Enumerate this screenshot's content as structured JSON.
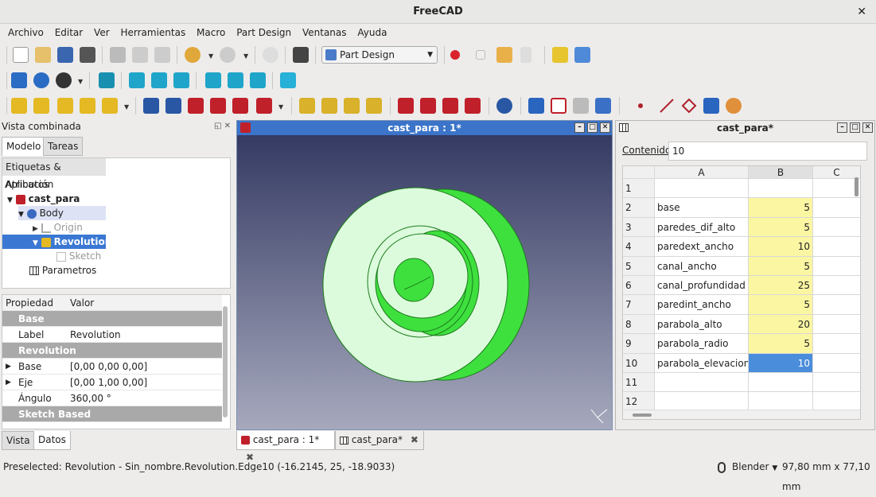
{
  "window": {
    "title": "FreeCAD",
    "close": "✕"
  },
  "menu": [
    "Archivo",
    "Editar",
    "Ver",
    "Herramientas",
    "Macro",
    "Part Design",
    "Ventanas",
    "Ayuda"
  ],
  "toolbar": {
    "workbench": "Part Design"
  },
  "combo": {
    "title": "Vista combinada",
    "tabs": [
      "Modelo",
      "Tareas"
    ],
    "tree_header": "Etiquetas & Atributos",
    "app_label": "Aplicación",
    "tree": [
      "cast_para",
      "Body",
      "Origin",
      "Revolution",
      "Sketch",
      "Parametros"
    ]
  },
  "props": {
    "col_prop": "Propiedad",
    "col_val": "Valor",
    "rows": [
      {
        "group": "Base"
      },
      {
        "name": "Label",
        "value": "Revolution"
      },
      {
        "group": "Revolution"
      },
      {
        "name": "Base",
        "value": "[0,00 0,00 0,00]"
      },
      {
        "name": "Eje",
        "value": "[0,00 1,00 0,00]"
      },
      {
        "name": "Ángulo",
        "value": "360,00 °"
      },
      {
        "group": "Sketch Based"
      }
    ],
    "view_tabs": [
      "Vista",
      "Datos"
    ]
  },
  "viewport": {
    "title": "cast_para : 1*"
  },
  "sheet": {
    "title": "cast_para*",
    "content_label": "Contenido",
    "content_value": "10",
    "cols": [
      "A",
      "B",
      "C"
    ],
    "rows": [
      {
        "n": "1",
        "a": "",
        "b": ""
      },
      {
        "n": "2",
        "a": "base",
        "b": "5"
      },
      {
        "n": "3",
        "a": "paredes_dif_alto",
        "b": "5"
      },
      {
        "n": "4",
        "a": "paredext_ancho",
        "b": "10"
      },
      {
        "n": "5",
        "a": "canal_ancho",
        "b": "5"
      },
      {
        "n": "6",
        "a": "canal_profundidad",
        "b": "25"
      },
      {
        "n": "7",
        "a": "paredint_ancho",
        "b": "5"
      },
      {
        "n": "8",
        "a": "parabola_alto",
        "b": "20"
      },
      {
        "n": "9",
        "a": "parabola_radio",
        "b": "5"
      },
      {
        "n": "10",
        "a": "parabola_elevacion",
        "b": "10"
      },
      {
        "n": "11",
        "a": "",
        "b": ""
      },
      {
        "n": "12",
        "a": "",
        "b": ""
      }
    ]
  },
  "doc_tabs": [
    "cast_para : 1*",
    "cast_para*"
  ],
  "status": {
    "text": "Preselected: Revolution - Sin_nombre.Revolution.Edge10 (-16.2145, 25, -18.9033)",
    "nav": "Blender",
    "dims": "97,80 mm x 77,10 mm"
  },
  "colors": {
    "accent": "#3b74c9",
    "model": "#3ee03e",
    "sheet_yellow": "#fbf6a2",
    "sheet_sel": "#4a8ddb"
  }
}
